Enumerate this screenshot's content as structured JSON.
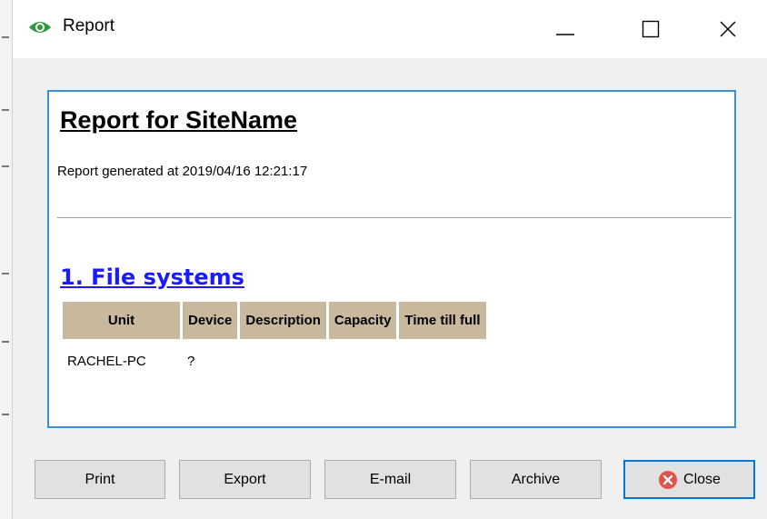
{
  "window": {
    "title": "Report"
  },
  "report": {
    "title": "Report for SiteName",
    "generated_text": "Report generated at 2019/04/16 12:21:17",
    "section_heading": "1. File systems",
    "table": {
      "headers": [
        "Unit",
        "Device",
        "Description",
        "Capacity",
        "Time till full"
      ],
      "rows": [
        [
          "RACHEL-PC",
          "?",
          "",
          "",
          ""
        ]
      ]
    }
  },
  "buttons": {
    "print": "Print",
    "export": "Export",
    "email": "E-mail",
    "archive": "Archive",
    "close": "Close"
  },
  "colors": {
    "panel_border": "#3a8fd8",
    "header_bg": "#c8b89e",
    "link": "#1a1aff",
    "close_icon": "#e0524a",
    "app_icon": "#2e9a3e"
  }
}
